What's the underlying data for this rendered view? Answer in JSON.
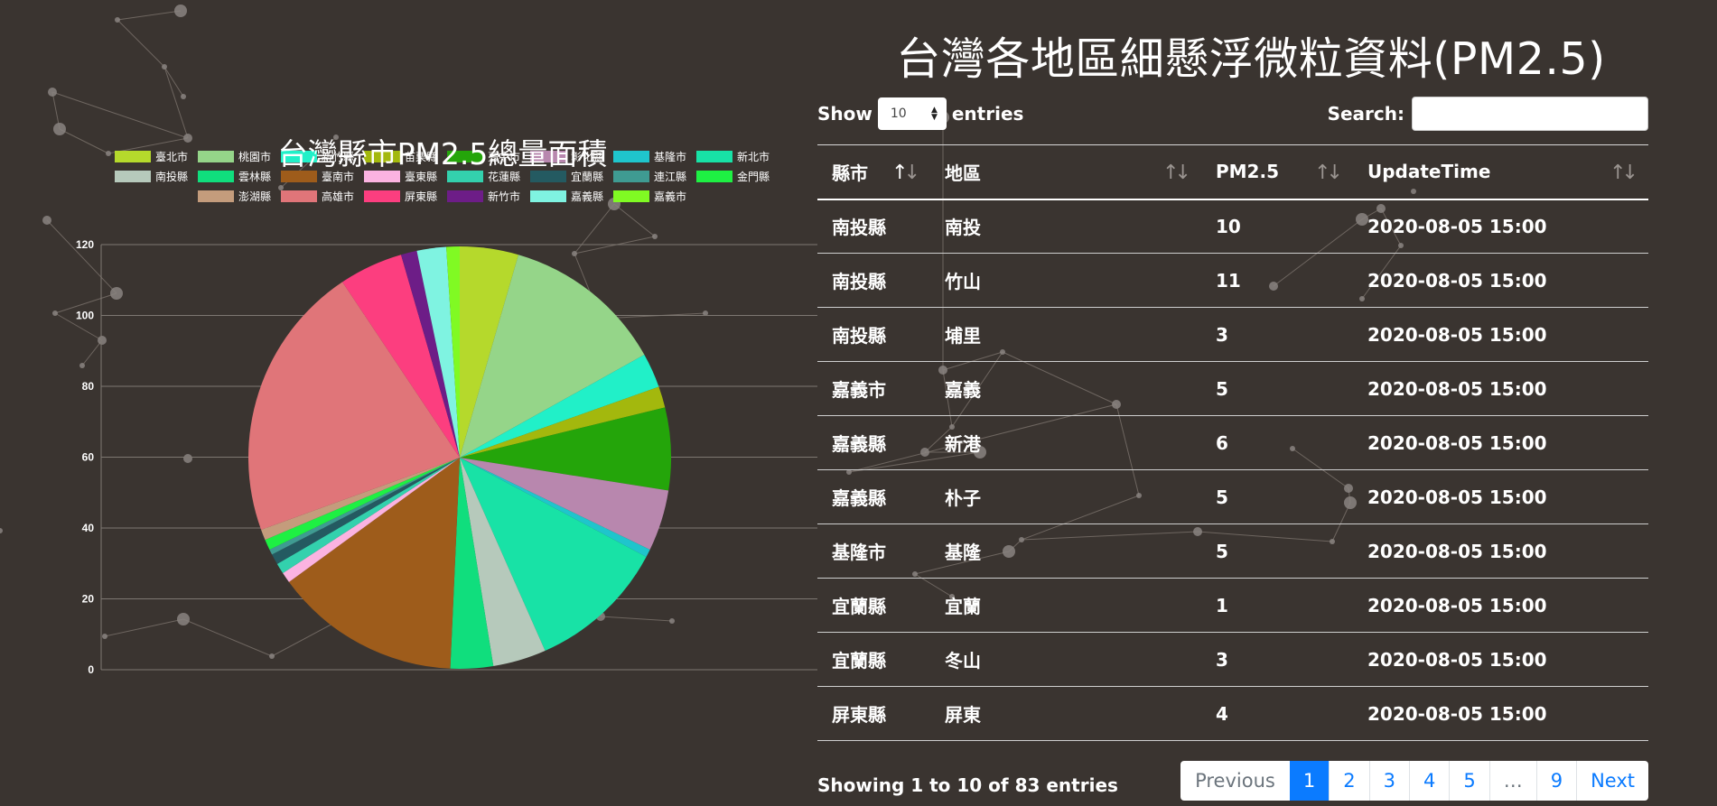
{
  "page": {
    "title": "台灣各地區細懸浮微粒資料(PM2.5)"
  },
  "controls": {
    "length_label_before": "Show",
    "length_value": "10",
    "length_label_after": "entries",
    "search_label": "Search:",
    "search_value": ""
  },
  "table": {
    "headers": [
      "縣市",
      "地區",
      "PM2.5",
      "UpdateTime"
    ],
    "rows": [
      [
        "南投縣",
        "南投",
        "10",
        "2020-08-05 15:00"
      ],
      [
        "南投縣",
        "竹山",
        "11",
        "2020-08-05 15:00"
      ],
      [
        "南投縣",
        "埔里",
        "3",
        "2020-08-05 15:00"
      ],
      [
        "嘉義市",
        "嘉義",
        "5",
        "2020-08-05 15:00"
      ],
      [
        "嘉義縣",
        "新港",
        "6",
        "2020-08-05 15:00"
      ],
      [
        "嘉義縣",
        "朴子",
        "5",
        "2020-08-05 15:00"
      ],
      [
        "基隆市",
        "基隆",
        "5",
        "2020-08-05 15:00"
      ],
      [
        "宜蘭縣",
        "宜蘭",
        "1",
        "2020-08-05 15:00"
      ],
      [
        "宜蘭縣",
        "冬山",
        "3",
        "2020-08-05 15:00"
      ],
      [
        "屏東縣",
        "屏東",
        "4",
        "2020-08-05 15:00"
      ]
    ],
    "info": "Showing 1 to 10 of 83 entries"
  },
  "pagination": {
    "previous": "Previous",
    "pages": [
      "1",
      "2",
      "3",
      "4",
      "5",
      "…",
      "9"
    ],
    "active": "1",
    "next": "Next"
  },
  "colors": {
    "background": "#3a3430",
    "page_active": "#0b7bff"
  },
  "chart_data": {
    "type": "pie",
    "title": "台灣縣市PM2.5總量面積",
    "legend_position": "top",
    "ylim": [
      0,
      120
    ],
    "yticks": [
      0,
      20,
      40,
      60,
      80,
      100,
      120
    ],
    "grid": true,
    "slices": [
      {
        "name": "臺北市",
        "value": 22,
        "color": "#b5d92c"
      },
      {
        "name": "桃園市",
        "value": 61,
        "color": "#95d589"
      },
      {
        "name": "新竹縣",
        "value": 13,
        "color": "#21f0c8"
      },
      {
        "name": "苗栗縣",
        "value": 8,
        "color": "#a3b80d"
      },
      {
        "name": "臺中市",
        "value": 31,
        "color": "#24a50a"
      },
      {
        "name": "彰化縣",
        "value": 23,
        "color": "#b887ae"
      },
      {
        "name": "基隆市",
        "value": 3,
        "color": "#1fc5cc"
      },
      {
        "name": "新北市",
        "value": 52,
        "color": "#18e2a6"
      },
      {
        "name": "南投縣",
        "value": 20,
        "color": "#b6c9bb"
      },
      {
        "name": "雲林縣",
        "value": 16,
        "color": "#10de7d"
      },
      {
        "name": "臺南市",
        "value": 70,
        "color": "#9e5c1b"
      },
      {
        "name": "臺東縣",
        "value": 4,
        "color": "#fbb3e1"
      },
      {
        "name": "花蓮縣",
        "value": 4,
        "color": "#33d1ad"
      },
      {
        "name": "宜蘭縣",
        "value": 4,
        "color": "#245a61"
      },
      {
        "name": "連江縣",
        "value": 2,
        "color": "#3f9b92"
      },
      {
        "name": "金門縣",
        "value": 4,
        "color": "#1ef043"
      },
      {
        "name": "澎湖縣",
        "value": 4,
        "color": "#c49c7c"
      },
      {
        "name": "高雄市",
        "value": 104,
        "color": "#e07579"
      },
      {
        "name": "屏東縣",
        "value": 24,
        "color": "#fc3e7f"
      },
      {
        "name": "新竹市",
        "value": 6,
        "color": "#6d1d87"
      },
      {
        "name": "嘉義縣",
        "value": 11,
        "color": "#7ff3e1"
      },
      {
        "name": "嘉義市",
        "value": 5,
        "color": "#80fa23"
      }
    ]
  }
}
